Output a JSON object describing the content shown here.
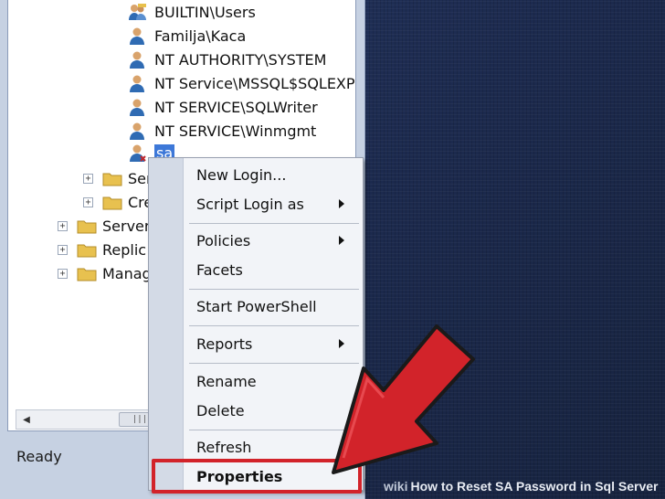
{
  "tree": {
    "logins": [
      {
        "label": "BUILTIN\\Users",
        "icon": "group-icon"
      },
      {
        "label": "Familja\\Kaca",
        "icon": "user-icon"
      },
      {
        "label": "NT AUTHORITY\\SYSTEM",
        "icon": "user-icon"
      },
      {
        "label": "NT Service\\MSSQL$SQLEXPR",
        "icon": "user-icon"
      },
      {
        "label": "NT SERVICE\\SQLWriter",
        "icon": "user-icon"
      },
      {
        "label": "NT SERVICE\\Winmgmt",
        "icon": "user-icon"
      },
      {
        "label": "sa",
        "icon": "user-icon"
      }
    ],
    "folders": [
      {
        "label": "Ser",
        "indent": 2
      },
      {
        "label": "Cre",
        "indent": 2
      },
      {
        "label": "Server",
        "indent": 1
      },
      {
        "label": "Replic",
        "indent": 1
      },
      {
        "label": "Manag",
        "indent": 1
      }
    ],
    "expander_symbol": "+"
  },
  "scrollbar": {
    "left_arrow": "◀",
    "thumb_grip": "|||"
  },
  "status": {
    "text": "Ready"
  },
  "context_menu": {
    "items": [
      {
        "label": "New Login...",
        "submenu": false
      },
      {
        "label": "Script Login as",
        "submenu": true
      },
      {
        "label": "Policies",
        "submenu": true
      },
      {
        "label": "Facets",
        "submenu": false
      },
      {
        "label": "Start PowerShell",
        "submenu": false
      },
      {
        "label": "Reports",
        "submenu": true
      },
      {
        "label": "Rename",
        "submenu": false
      },
      {
        "label": "Delete",
        "submenu": false
      },
      {
        "label": "Refresh",
        "submenu": false
      },
      {
        "label": "Properties",
        "submenu": false,
        "highlighted": true
      }
    ]
  },
  "annotation": {
    "arrow_color": "#d2232a",
    "highlight_color": "#d2232a"
  },
  "watermark": {
    "brand": "wiki",
    "text": "How to Reset SA Password in Sql Server"
  }
}
